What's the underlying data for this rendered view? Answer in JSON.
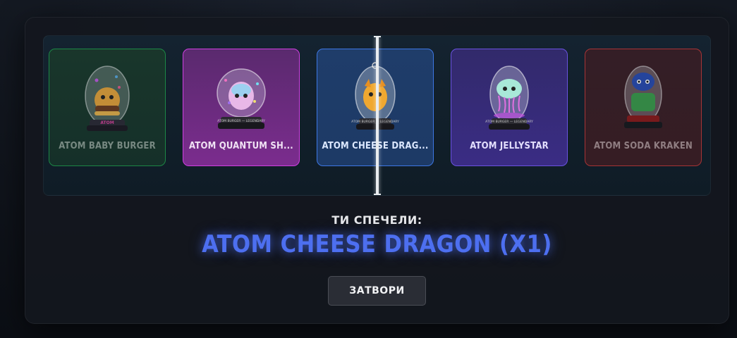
{
  "reel": {
    "items": [
      {
        "name": "ATOM BABY BURGER",
        "rarity_color": "#1f9a4b"
      },
      {
        "name": "ATOM QUANTUM SH...",
        "rarity_color": "#cf3fe0"
      },
      {
        "name": "ATOM CHEESE DRAG...",
        "rarity_color": "#3d77e3"
      },
      {
        "name": "ATOM JELLYSTAR",
        "rarity_color": "#6a52e0"
      },
      {
        "name": "ATOM SODA KRAKEN",
        "rarity_color": "#c23838"
      }
    ]
  },
  "result": {
    "label": "ТИ СПЕЧЕЛИ:",
    "item": "ATOM CHEESE DRAGON (X1)",
    "accent_color": "#4d6ff0"
  },
  "close_button": {
    "label": "ЗАТВОРИ"
  }
}
